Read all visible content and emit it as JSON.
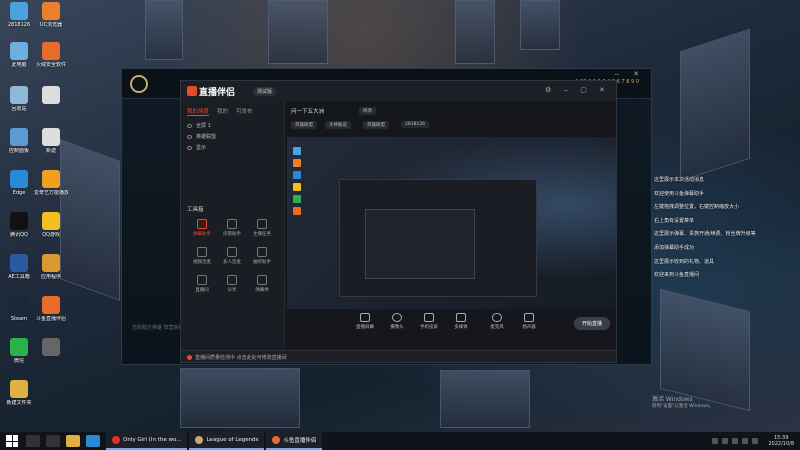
{
  "desktop": {
    "icons": [
      {
        "label": "2818126",
        "color": "#4aa3df"
      },
      {
        "label": "UC浏览器",
        "color": "#e8812a"
      },
      {
        "label": "此电脑",
        "color": "#6bb0e0"
      },
      {
        "label": "火绒安全软件",
        "color": "#e86b2a"
      },
      {
        "label": "回收站",
        "color": "#8fb8d8"
      },
      {
        "label": "",
        "color": "#dddddd"
      },
      {
        "label": "控制面板",
        "color": "#5d9ad6"
      },
      {
        "label": "新建",
        "color": "#dddddd"
      },
      {
        "label": "Edge",
        "color": "#2b8ad6"
      },
      {
        "label": "爱奇艺万能播放器",
        "color": "#f0a020"
      },
      {
        "label": "腾讯QQ",
        "color": "#111111"
      },
      {
        "label": "QQ游戏",
        "color": "#f0c020"
      },
      {
        "label": "AE工具箱",
        "color": "#2a5aa0"
      },
      {
        "label": "应用程序",
        "color": "#d89a30"
      },
      {
        "label": "Steam",
        "color": "#1b2838"
      },
      {
        "label": "斗鱼直播伴侣",
        "color": "#e86b2a"
      },
      {
        "label": "微信",
        "color": "#2bb24c"
      },
      {
        "label": "",
        "color": "#666666"
      },
      {
        "label": "新建文件夹",
        "color": "#e0b040"
      }
    ]
  },
  "lol_window": {
    "right_text": "9:53  0 1 2 3 4 5 6 7 8 9 0",
    "side_text": "击败敌方英雄 阵营获得金币与经验 击杀小兵"
  },
  "obs": {
    "app_name": "直播伴侣",
    "version_badge": "测试版",
    "tabs": [
      "我的场景",
      "我的",
      "可发布"
    ],
    "scenes": [
      "全屏 1",
      "英雄联盟",
      "显示"
    ],
    "tools_title": "工具箱",
    "tools": [
      {
        "label": "弹幕助手",
        "hot": true
      },
      {
        "label": "房管助手",
        "hot": false
      },
      {
        "label": "主播任务",
        "hot": false
      },
      {
        "label": "视频连麦",
        "hot": false
      },
      {
        "label": "多人连麦",
        "hot": false
      },
      {
        "label": "抽奖助手",
        "hot": false
      },
      {
        "label": "直播间",
        "hot": false
      },
      {
        "label": "分享",
        "hot": false
      },
      {
        "label": "弹幕秀",
        "hot": false
      }
    ],
    "topic_title": "问一下五大洲",
    "topic_edit": "修改",
    "chips": [
      "英雄联盟",
      "大神解说",
      "英雄联盟",
      "2818126"
    ],
    "bottom_buttons": [
      "直播屏幕",
      "摄像头",
      "手机投屏",
      "多媒体",
      "麦克风",
      "扬声器"
    ],
    "start_label": "开始直播",
    "status_notice": "直播间质量检测中 点击此处可修改直播间"
  },
  "chat_panel": {
    "lines": [
      "这里展示本次活动消息",
      "欢迎使用斗鱼弹幕助手",
      "左键拖拽调整位置，右键控制缩放大小",
      "右上角有设置菜单",
      "这里展示弹幕、贵族开通/续费、粉丝牌升级等",
      "添加弹幕助手成功",
      "这里展示收到的礼物、道具",
      "欢迎来到斗鱼直播间"
    ]
  },
  "watermark": {
    "title": "激活 Windows",
    "subtitle": "转到\"设置\"以激活 Windows。"
  },
  "taskbar": {
    "apps": [
      {
        "label": "Only Girl (In the wo...",
        "color": "#e0322a"
      },
      {
        "label": "League of Legends",
        "color": "#c8aa6e"
      },
      {
        "label": "斗鱼直播伴侣",
        "color": "#e86b2a"
      }
    ],
    "time": "15:39",
    "date": "2022/10/8"
  }
}
